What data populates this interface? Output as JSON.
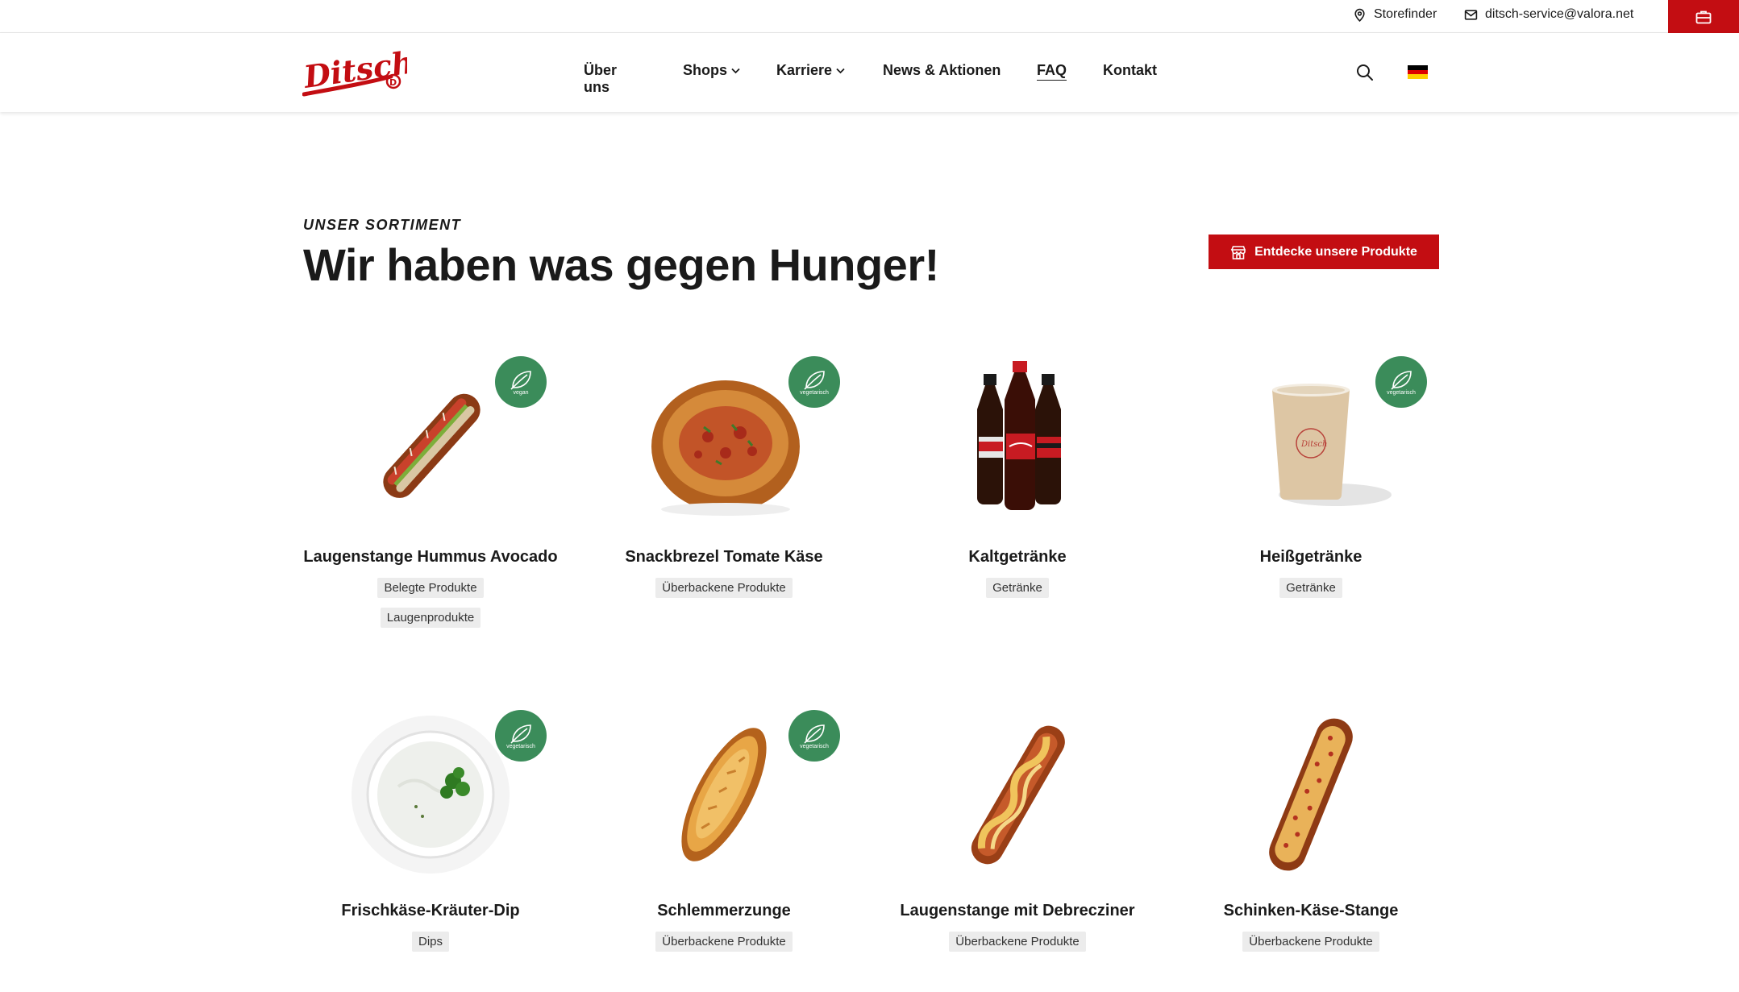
{
  "topbar": {
    "storefinder_label": "Storefinder",
    "email_label": "ditsch-service@valora.net"
  },
  "nav": {
    "items": [
      {
        "label": "Über uns",
        "has_dropdown": false
      },
      {
        "label": "Shops",
        "has_dropdown": true
      },
      {
        "label": "Karriere",
        "has_dropdown": true
      },
      {
        "label": "News & Aktionen",
        "has_dropdown": false
      },
      {
        "label": "FAQ",
        "has_dropdown": false
      },
      {
        "label": "Kontakt",
        "has_dropdown": false
      }
    ],
    "language": "de"
  },
  "brand": {
    "name": "Ditsch",
    "primary_color": "#c30d12",
    "badge_color": "#3b8c5a"
  },
  "hero": {
    "kicker": "UNSER SORTIMENT",
    "headline": "Wir haben was gegen Hunger!",
    "cta_label": "Entdecke unsere Produkte"
  },
  "products": [
    {
      "name": "Laugenstange Hummus Avocado",
      "badge": "vegan",
      "tags": [
        "Belegte Produkte",
        "Laugenprodukte"
      ],
      "image": "laugenstange-icon"
    },
    {
      "name": "Snackbrezel Tomate Käse",
      "badge": "vegetarisch",
      "tags": [
        "Überbackene Produkte"
      ],
      "image": "brezel-icon"
    },
    {
      "name": "Kaltgetränke",
      "badge": "",
      "tags": [
        "Getränke"
      ],
      "image": "cola-bottles-icon"
    },
    {
      "name": "Heißgetränke",
      "badge": "vegetarisch",
      "tags": [
        "Getränke"
      ],
      "image": "coffee-cup-icon"
    },
    {
      "name": "Frischkäse-Kräuter-Dip",
      "badge": "vegetarisch",
      "tags": [
        "Dips"
      ],
      "image": "dip-bowl-icon"
    },
    {
      "name": "Schlemmerzunge",
      "badge": "vegetarisch",
      "tags": [
        "Überbackene Produkte"
      ],
      "image": "schlemmerzunge-icon"
    },
    {
      "name": "Laugenstange mit Debrecziner",
      "badge": "",
      "tags": [
        "Überbackene Produkte"
      ],
      "image": "debrecziner-icon"
    },
    {
      "name": "Schinken-Käse-Stange",
      "badge": "",
      "tags": [
        "Überbackene Produkte"
      ],
      "image": "schinken-stange-icon"
    }
  ]
}
